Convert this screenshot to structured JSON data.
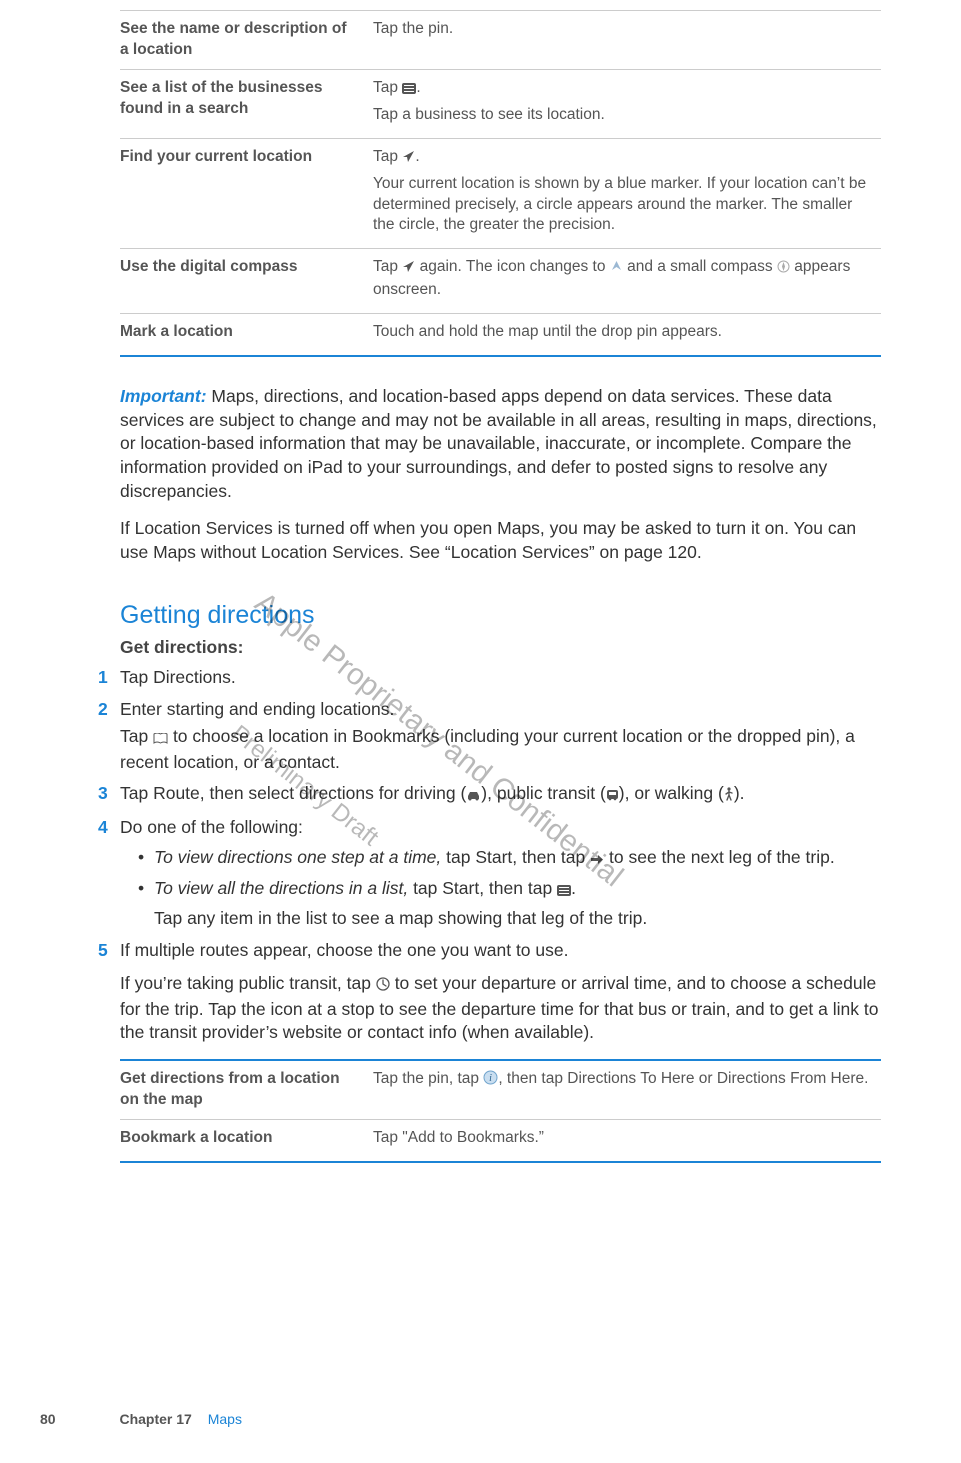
{
  "table1": {
    "rows": [
      {
        "left": "See the name or description of a location",
        "right": [
          "Tap the pin."
        ]
      },
      {
        "left": "See a list of the businesses found in a search",
        "right": [
          "Tap ≣.",
          "Tap a business to see its location."
        ]
      },
      {
        "left": "Find your current location",
        "right": [
          "Tap ➤.",
          "Your current location is shown by a blue marker. If your location can’t be determined precisely, a circle appears around the marker. The smaller the circle, the greater the precision."
        ]
      },
      {
        "left": "Use the digital compass",
        "right": [
          "Tap ➤ again. The icon changes to ⍋ and a small compass ✲ appears onscreen."
        ]
      },
      {
        "left": "Mark a location",
        "right": [
          "Touch and hold the map until the drop pin appears."
        ]
      }
    ]
  },
  "important": {
    "label": "Important:  ",
    "text": "Maps, directions, and location-based apps depend on data services. These data services are subject to change and may not be available in all areas, resulting in maps, directions, or location-based information that may be unavailable, inaccurate, or incomplete. Compare the information provided on iPad to your surroundings, and defer to posted signs to resolve any discrepancies."
  },
  "para2": "If Location Services is turned off when you open Maps, you may be asked to turn it on. You can use Maps without Location Services. See “Location Services” on page 120.",
  "section_title": "Getting directions",
  "subhead": "Get directions:",
  "steps": {
    "s1": "Tap Directions.",
    "s2": "Enter starting and ending locations.",
    "s2_p": "Tap 📖 to choose a location in Bookmarks (including your current location or the dropped pin), a recent location, or a contact.",
    "s3": "Tap Route, then select directions for driving (🚗), public transit (🚌), or walking (🚶).",
    "s4": "Do one of the following:",
    "s4_b1_i": "To view directions one step at a time,",
    "s4_b1_r": " tap Start, then tap ➡ to see the next leg of the trip.",
    "s4_b2_i": "To view all the directions in a list,",
    "s4_b2_r": " tap Start, then tap ≣.",
    "s4_p": "Tap any item in the list to see a map showing that leg of the trip.",
    "s5": "If multiple routes appear, choose the one you want to use."
  },
  "para3": "If you’re taking public transit, tap 🕘 to set your departure or arrival time, and to choose a schedule for the trip. Tap the icon at a stop to see the departure time for that bus or train, and to get a link to the transit provider’s website or contact info (when available).",
  "table2": {
    "r1_left": "Get directions from a location on the map",
    "r1_right": "Tap the pin, tap ⓘ, then tap Directions To Here or Directions From Here.",
    "r2_left": "Bookmark a location",
    "r2_right": "Tap \"Add to Bookmarks.”"
  },
  "watermarks": {
    "w1": "Apple Proprietary and Confidential",
    "w2": "Preliminary Draft"
  },
  "footer": {
    "page": "80",
    "chapter": "Chapter 17",
    "title": "Maps"
  },
  "icons": {
    "list": "list-icon",
    "locate": "location-arrow-icon",
    "compass_mode": "compass-mode-icon",
    "compass": "compass-icon",
    "book": "book-icon",
    "car": "car-icon",
    "bus": "bus-icon",
    "walk": "walk-icon",
    "arrow_right": "arrow-right-icon",
    "clock": "clock-icon",
    "info": "info-icon"
  }
}
